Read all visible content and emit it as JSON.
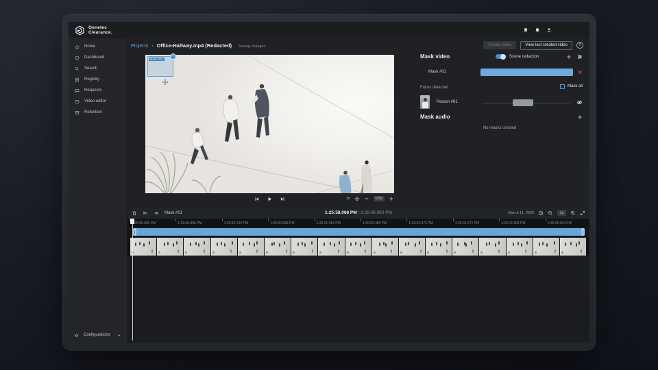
{
  "brand": {
    "line1": "Genetec",
    "line2": "Clearance."
  },
  "topbar": {
    "icons": [
      "bookmark",
      "bell",
      "person"
    ]
  },
  "sidebar": {
    "items": [
      {
        "label": "Home",
        "icon": "home"
      },
      {
        "label": "Dashboard",
        "icon": "dashboard"
      },
      {
        "label": "Search",
        "icon": "search"
      },
      {
        "label": "Registry",
        "icon": "registry"
      },
      {
        "label": "Requests",
        "icon": "requests"
      },
      {
        "label": "Video editor",
        "icon": "video-editor"
      },
      {
        "label": "Retention",
        "icon": "retention"
      }
    ],
    "footer": {
      "label": "Configurations"
    }
  },
  "header": {
    "breadcrumb_root": "Projects",
    "breadcrumb_sep": "›",
    "title": "Office-Hallway.mp4 (Redacted)",
    "status": "Saving changes...",
    "create_btn": "Create video",
    "view_btn": "View last created video",
    "help": "?"
  },
  "player": {
    "mask_overlay_label": "Mask #01",
    "speed": "1x",
    "step": "0.5s"
  },
  "mask_panel": {
    "title": "Mask video",
    "scene_redaction": "Scene redaction",
    "mask_name": "Mask #01",
    "faces_detected": "Faces detected",
    "mask_all": "Mask all",
    "person_name": "Person #01",
    "audio_title": "Mask audio",
    "no_masks": "No masks created"
  },
  "timeline": {
    "mask_label": "Mask #01",
    "current_time": "1:25:58.068 PM",
    "separator": " / ",
    "end_time": "1:26:06.960 PM",
    "date": "March 11, 2025",
    "zoom": "1x",
    "ticks": [
      "1:25:58.000 PM",
      "1:25:58.896 PM",
      "1:25:59.792 PM",
      "1:26:00.688 PM",
      "1:26:01.584 PM",
      "1:26:02.480 PM",
      "1:26:03.376 PM",
      "1:26:04.272 PM",
      "1:26:05.168 PM",
      "1:26:06.064 PM"
    ],
    "thumb_count": 17
  },
  "colors": {
    "accent_blue": "#64a8e0",
    "mask_bar_blue": "#68a5d9",
    "toggle_on": "#4a89c4",
    "close_red": "#e2574e",
    "panel_bg": "#1f2124",
    "timeline_bg": "#1a1c1f"
  }
}
